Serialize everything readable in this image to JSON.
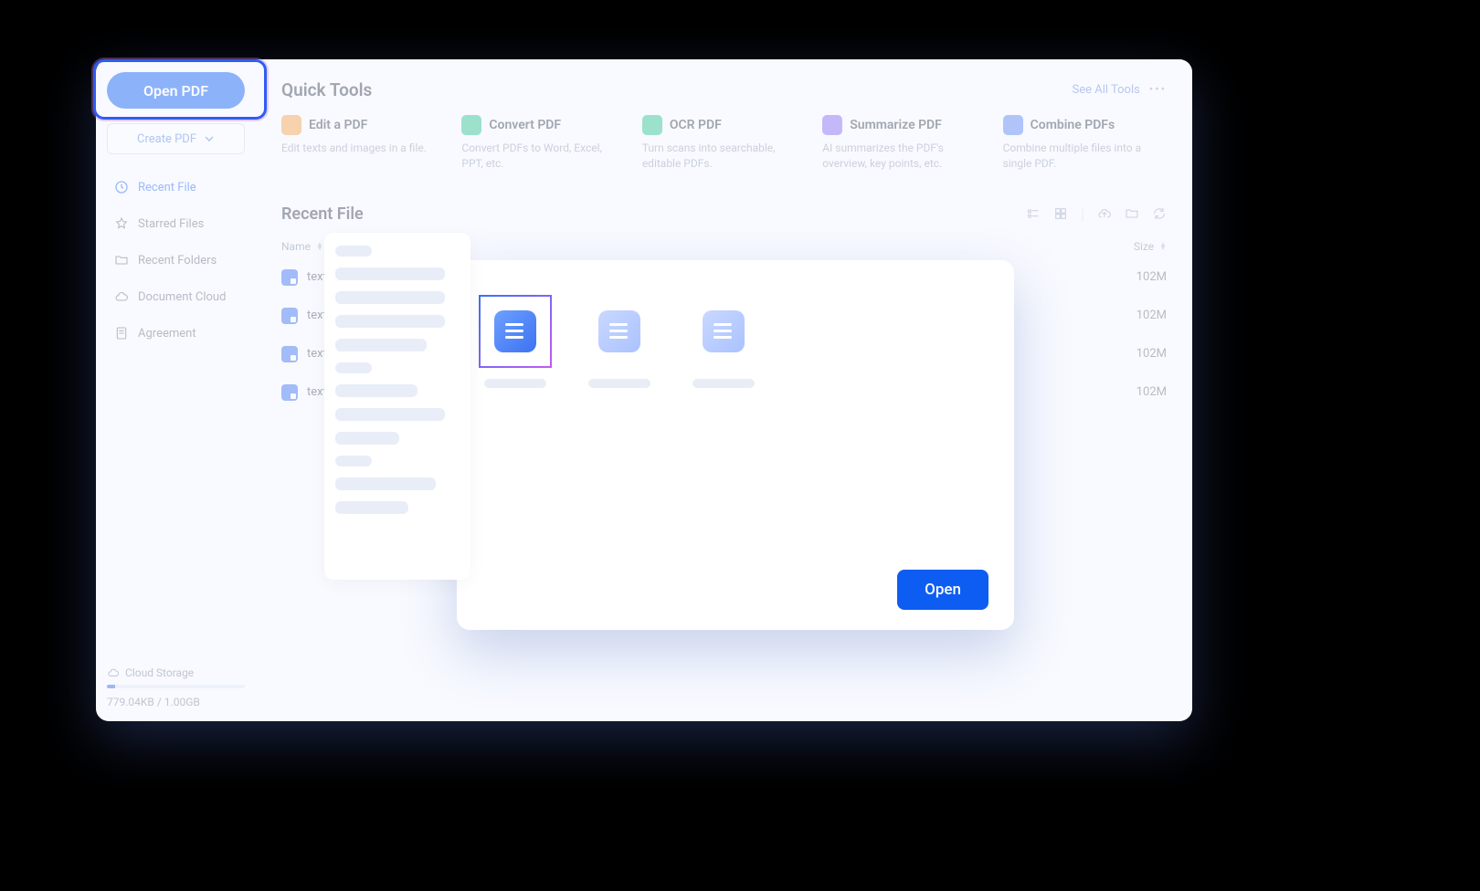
{
  "sidebar": {
    "open_label": "Open PDF",
    "create_label": "Create PDF",
    "items": [
      {
        "label": "Recent File",
        "active": true
      },
      {
        "label": "Starred Files",
        "active": false
      },
      {
        "label": "Recent Folders",
        "active": false
      },
      {
        "label": "Document Cloud",
        "active": false
      },
      {
        "label": "Agreement",
        "active": false
      }
    ],
    "storage": {
      "label": "Cloud Storage",
      "text": "779.04KB / 1.00GB"
    }
  },
  "quick_tools": {
    "title": "Quick Tools",
    "see_all": "See All Tools",
    "tools": [
      {
        "title": "Edit a PDF",
        "desc": "Edit texts and images in a file.",
        "color": "#f6a54a"
      },
      {
        "title": "Convert PDF",
        "desc": "Convert PDFs to Word, Excel, PPT, etc.",
        "color": "#2fc58f"
      },
      {
        "title": "OCR PDF",
        "desc": "Turn scans into searchable, editable PDFs.",
        "color": "#2fc58f"
      },
      {
        "title": "Summarize PDF",
        "desc": "AI summarizes the PDF's overview, key points, etc.",
        "color": "#8a6cf2"
      },
      {
        "title": "Combine PDFs",
        "desc": "Combine multiple files into a single PDF.",
        "color": "#5b86f2"
      }
    ]
  },
  "recent": {
    "title": "Recent File",
    "cols": {
      "name": "Name",
      "size": "Size"
    },
    "rows": [
      {
        "name": "texttexttexttexttext",
        "size": "102M"
      },
      {
        "name": "texttexttexttexttext",
        "size": "102M"
      },
      {
        "name": "texttexttexttexttext",
        "size": "102M"
      },
      {
        "name": "texttexttexttexttext",
        "size": "102M"
      }
    ]
  },
  "dialog": {
    "open_label": "Open"
  }
}
